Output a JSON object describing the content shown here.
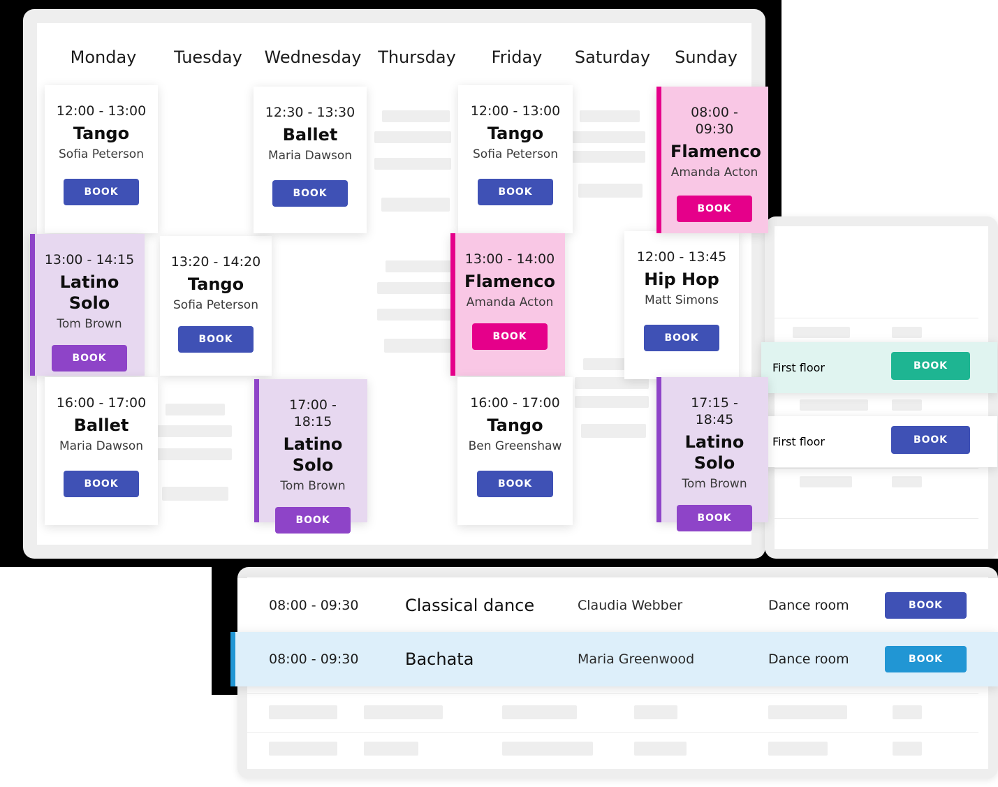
{
  "colors": {
    "indigo": "#3f51b5",
    "purple": "#8e44c8",
    "pink": "#e5008a",
    "teal": "#1eb592",
    "blue": "#2196d4",
    "card_purple_bg": "#e7d8f0",
    "card_pink_bg": "#f9c7e5",
    "row_teal_bg": "#e0f4f0",
    "row_blue_bg": "#ddeffa",
    "skeleton": "#eeeeee"
  },
  "book_label": "BOOK",
  "calendar": {
    "days": [
      {
        "name": "Monday"
      },
      {
        "name": "Tuesday"
      },
      {
        "name": "Wednesday"
      },
      {
        "name": "Thursday"
      },
      {
        "name": "Friday"
      },
      {
        "name": "Saturday"
      },
      {
        "name": "Sunday"
      }
    ],
    "events": [
      {
        "day": "Monday",
        "time": "12:00 - 13:00",
        "title": "Tango",
        "teacher": "Sofia Peterson",
        "book": "BOOK",
        "theme": "default"
      },
      {
        "day": "Monday",
        "time": "13:00 - 14:15",
        "title": "Latino Solo",
        "teacher": "Tom Brown",
        "book": "BOOK",
        "theme": "purple"
      },
      {
        "day": "Monday",
        "time": "16:00 - 17:00",
        "title": "Ballet",
        "teacher": "Maria Dawson",
        "book": "BOOK",
        "theme": "default"
      },
      {
        "day": "Tuesday",
        "time": "13:20 - 14:20",
        "title": "Tango",
        "teacher": "Sofia Peterson",
        "book": "BOOK",
        "theme": "default"
      },
      {
        "day": "Wednesday",
        "time": "12:30 - 13:30",
        "title": "Ballet",
        "teacher": "Maria Dawson",
        "book": "BOOK",
        "theme": "default"
      },
      {
        "day": "Wednesday",
        "time": "17:00 - 18:15",
        "title": "Latino Solo",
        "teacher": "Tom Brown",
        "book": "BOOK",
        "theme": "purple"
      },
      {
        "day": "Friday",
        "time": "12:00 - 13:00",
        "title": "Tango",
        "teacher": "Sofia Peterson",
        "book": "BOOK",
        "theme": "default"
      },
      {
        "day": "Friday",
        "time": "13:00 - 14:00",
        "title": "Flamenco",
        "teacher": "Amanda Acton",
        "book": "BOOK",
        "theme": "pink"
      },
      {
        "day": "Friday",
        "time": "16:00 - 17:00",
        "title": "Tango",
        "teacher": "Ben Greenshaw",
        "book": "BOOK",
        "theme": "default"
      },
      {
        "day": "Saturday",
        "time": "12:00 - 13:45",
        "title": "Hip Hop",
        "teacher": "Matt Simons",
        "book": "BOOK",
        "theme": "default"
      },
      {
        "day": "Sunday",
        "time": "08:00 - 09:30",
        "title": "Flamenco",
        "teacher": "Amanda Acton",
        "book": "BOOK",
        "theme": "pink"
      },
      {
        "day": "Sunday",
        "time": "17:15 - 18:45",
        "title": "Latino Solo",
        "teacher": "Tom Brown",
        "book": "BOOK",
        "theme": "purple"
      }
    ]
  },
  "room_panel": {
    "rows": [
      {
        "room": "First floor",
        "book": "BOOK",
        "theme": "teal"
      },
      {
        "room": "First floor",
        "book": "BOOK",
        "theme": "indigo"
      }
    ]
  },
  "list_panel": {
    "rows": [
      {
        "time": "08:00 - 09:30",
        "class": "Classical dance",
        "teacher": "Claudia Webber",
        "room": "Dance room",
        "book": "BOOK",
        "theme": "default"
      },
      {
        "time": "08:00 - 09:30",
        "class": "Bachata",
        "teacher": "Maria Greenwood",
        "room": "Dance room",
        "book": "BOOK",
        "theme": "blue"
      }
    ]
  }
}
